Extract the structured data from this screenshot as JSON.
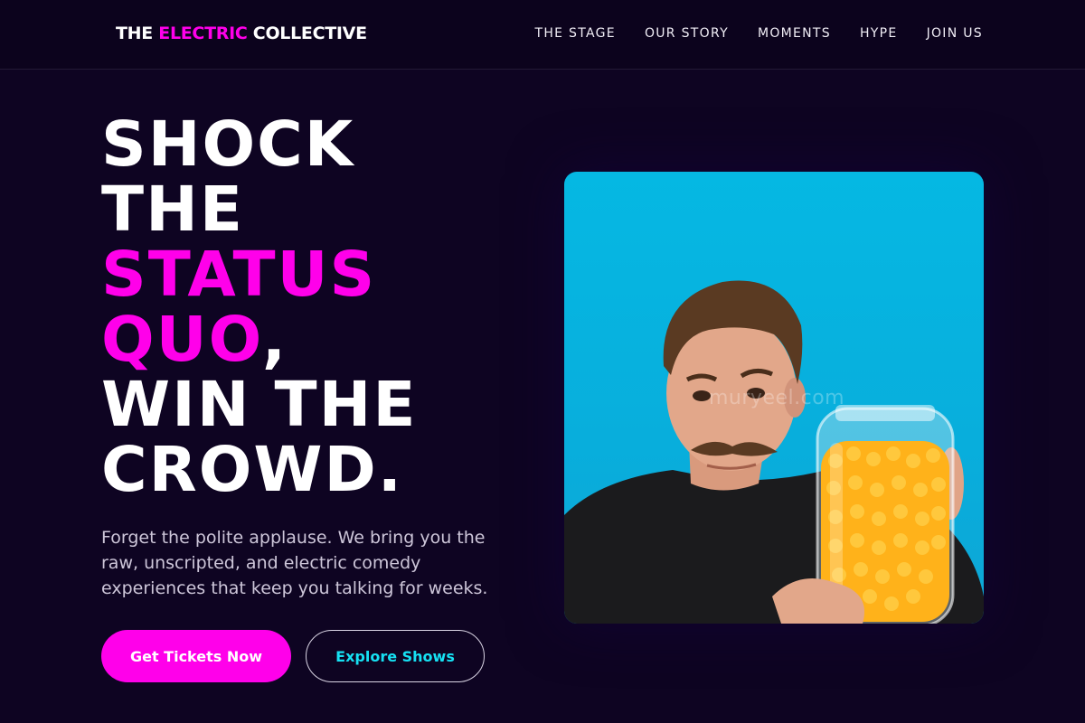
{
  "nav": {
    "logo": {
      "part1": "THE ",
      "part2": "ELECTRIC",
      "part3": " COLLECTIVE"
    },
    "links": [
      "THE STAGE",
      "OUR STORY",
      "MOMENTS",
      "HYPE",
      "JOIN US"
    ]
  },
  "hero": {
    "title_lines": {
      "l1": "SHOCK",
      "l2": "THE",
      "l3": "STATUS",
      "l4_accent": "QUO",
      "l4_rest": ",",
      "l5": "WIN THE",
      "l6": "CROWD."
    },
    "subtitle": "Forget the polite applause. We bring you the raw, unscripted, and electric comedy experiences that keep you talking for weeks.",
    "primary_button": "Get Tickets Now",
    "secondary_button": "Explore Shows"
  },
  "photo": {
    "description_icon": "comedian-photo",
    "watermark": "muryeel.com"
  },
  "colors": {
    "background": "#0e0422",
    "accent_magenta": "#ff00ea",
    "accent_cyan": "#16e1f3",
    "photo_backdrop": "#05b8e3"
  }
}
